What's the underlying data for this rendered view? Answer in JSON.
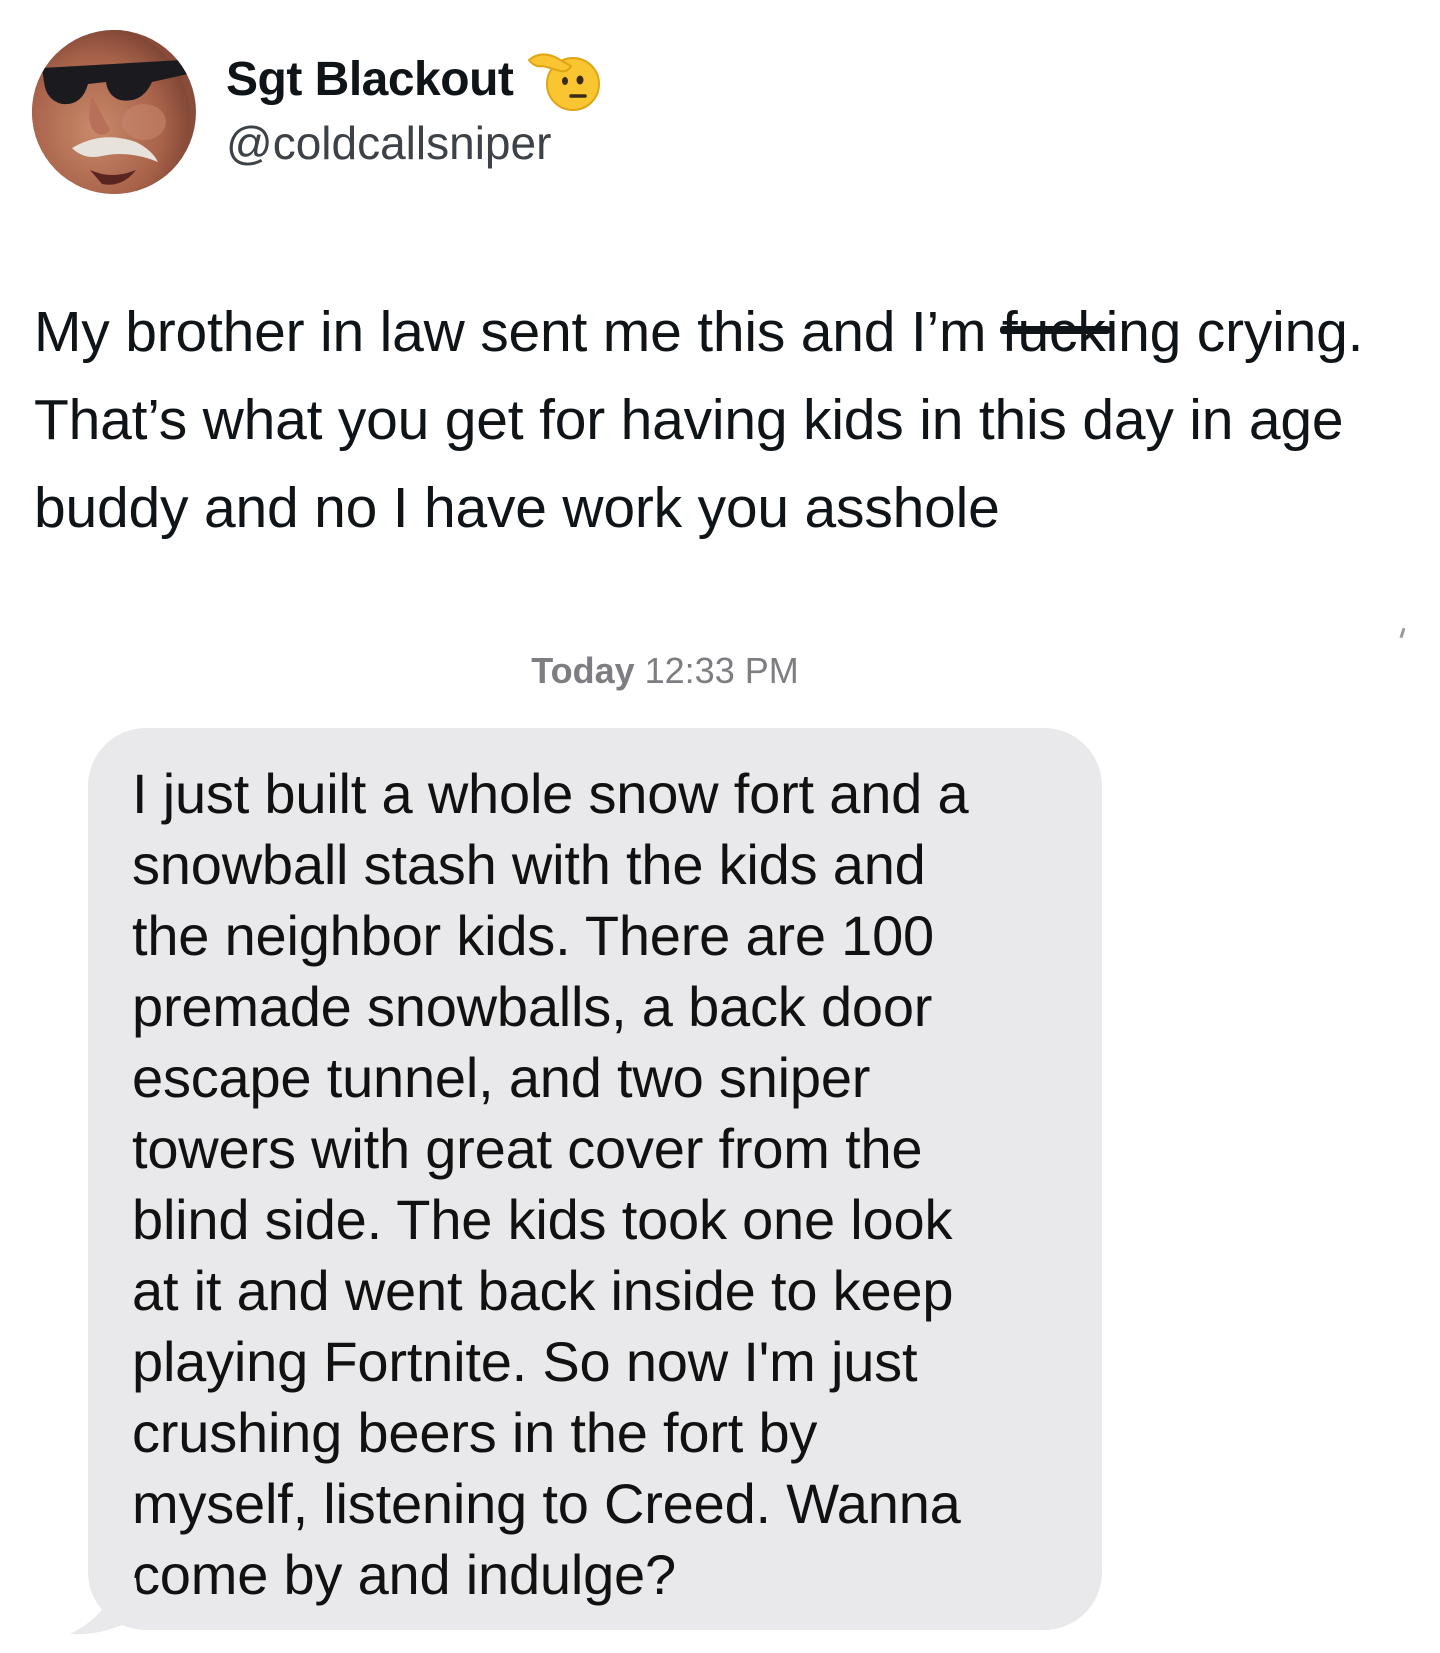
{
  "author": {
    "display_name": "Sgt Blackout",
    "badge_icon": "saluting-face-icon",
    "handle": "@coldcallsniper"
  },
  "tweet": {
    "text_before": "My brother in law sent me this and I’m ",
    "text_censored": "fuck",
    "text_after": "ing crying. That’s what you get for having kids in this day in age buddy and no I have work you asshole"
  },
  "message": {
    "timestamp_day": "Today",
    "timestamp_time": "12:33 PM",
    "bubble_text": "I just built a whole snow fort and a\nsnowball stash with the kids and\nthe neighbor kids. There are 100\npremade snowballs, a back door\nescape tunnel, and two sniper\ntowers with great cover from the\nblind side. The kids took one look\nat it and went back inside to keep\nplaying Fortnite. So now I'm just\ncrushing beers in the fort by\nmyself, listening to Creed. Wanna\ncome by and indulge?"
  },
  "colors": {
    "bubble_bg": "#e9e9eb",
    "timestamp": "#7d7d82",
    "text": "#0f1419",
    "handle": "#3c4247"
  }
}
